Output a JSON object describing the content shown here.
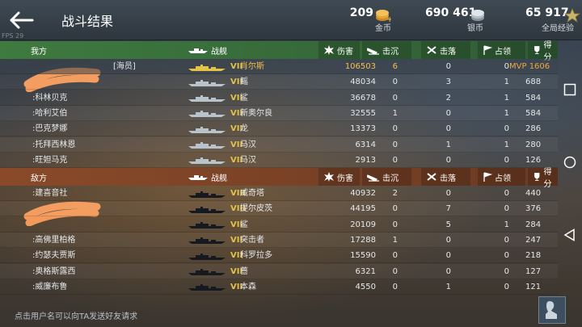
{
  "header": {
    "title": "战斗结果",
    "fps": "FPS 29",
    "gold": {
      "amount": "209",
      "label": "金币"
    },
    "silver": {
      "amount": "690 461",
      "label": "银币"
    },
    "exp": {
      "amount": "65 917",
      "label": "全局经验"
    }
  },
  "columns": {
    "ship": "战舰",
    "damage": "伤害",
    "sunk": "击沉",
    "downed": "击落",
    "capture": "占领",
    "score": "得分"
  },
  "ours": {
    "title": "我方",
    "rows": [
      {
        "name": "",
        "tag": "[海员]",
        "tier": "VII",
        "ship": "肖尔斯",
        "damage": "106503",
        "sunk": "6",
        "downed": "0",
        "capture": "0",
        "mvp": "MVP",
        "score": "1606"
      },
      {
        "name": "",
        "tag": "",
        "tier": "VII",
        "ship": "鳐",
        "damage": "48034",
        "sunk": "0",
        "downed": "3",
        "capture": "1",
        "mvp": "",
        "score": "688"
      },
      {
        "name": ":科林贝克",
        "tag": "",
        "tier": "VII",
        "ship": "鲨",
        "damage": "36678",
        "sunk": "0",
        "downed": "2",
        "capture": "1",
        "mvp": "",
        "score": "584"
      },
      {
        "name": ":哈利艾伯",
        "tag": "",
        "tier": "VII",
        "ship": "新奥尔良",
        "damage": "32555",
        "sunk": "1",
        "downed": "0",
        "capture": "1",
        "mvp": "",
        "score": "584"
      },
      {
        "name": ":巴克梦娜",
        "tag": "",
        "tier": "VII",
        "ship": "龙",
        "damage": "13373",
        "sunk": "0",
        "downed": "0",
        "capture": "0",
        "mvp": "",
        "score": "286"
      },
      {
        "name": ":托拜西林恩",
        "tag": "",
        "tier": "VII",
        "ship": "马汉",
        "damage": "6314",
        "sunk": "0",
        "downed": "1",
        "capture": "1",
        "mvp": "",
        "score": "280"
      },
      {
        "name": ":旺妲马克",
        "tag": "",
        "tier": "VII",
        "ship": "马汉",
        "damage": "2913",
        "sunk": "0",
        "downed": "0",
        "capture": "0",
        "mvp": "",
        "score": "126"
      }
    ]
  },
  "enemy": {
    "title": "敌方",
    "rows": [
      {
        "name": ":建喜音社",
        "tier": "VIII",
        "ship": "威奇塔",
        "damage": "40932",
        "sunk": "2",
        "downed": "0",
        "capture": "0",
        "score": "440"
      },
      {
        "name": "",
        "tier": "VIII",
        "ship": "提尔皮茨",
        "damage": "44195",
        "sunk": "0",
        "downed": "7",
        "capture": "0",
        "score": "376"
      },
      {
        "name": "",
        "tier": "VII",
        "ship": "鲨",
        "damage": "20109",
        "sunk": "0",
        "downed": "5",
        "capture": "1",
        "score": "284"
      },
      {
        "name": ":高佛里柏格",
        "tier": "VII",
        "ship": "突击者",
        "damage": "17288",
        "sunk": "1",
        "downed": "0",
        "capture": "0",
        "score": "247"
      },
      {
        "name": ":约瑟夫贾斯",
        "tier": "VII",
        "ship": "科罗拉多",
        "damage": "15590",
        "sunk": "0",
        "downed": "0",
        "capture": "0",
        "score": "218"
      },
      {
        "name": ":奥格斯露西",
        "tier": "VII",
        "ship": "蔷",
        "damage": "6321",
        "sunk": "0",
        "downed": "0",
        "capture": "0",
        "score": "127"
      },
      {
        "name": ":威廉布鲁",
        "tier": "VII",
        "ship": "本森",
        "damage": "4550",
        "sunk": "0",
        "downed": "1",
        "capture": "0",
        "score": "121"
      }
    ]
  },
  "footer": {
    "hint": "点击用户名可以向TA发送好友请求"
  },
  "icons": {
    "back": "arrow-left-icon",
    "gold": "gold-coins-icon",
    "silver": "silver-coins-icon",
    "exp": "star-exp-icon",
    "damage": "explosion-icon",
    "sunk": "sinking-ship-icon",
    "downed": "plane-shot-icon",
    "capture": "flag-icon",
    "score": "trophy-icon",
    "friend": "add-friend-icon"
  },
  "colors": {
    "ours_header": "#3f7a3f",
    "enemy_header": "#8a4a2a",
    "tier": "#e3c24a",
    "highlight": "#f1c04a"
  }
}
